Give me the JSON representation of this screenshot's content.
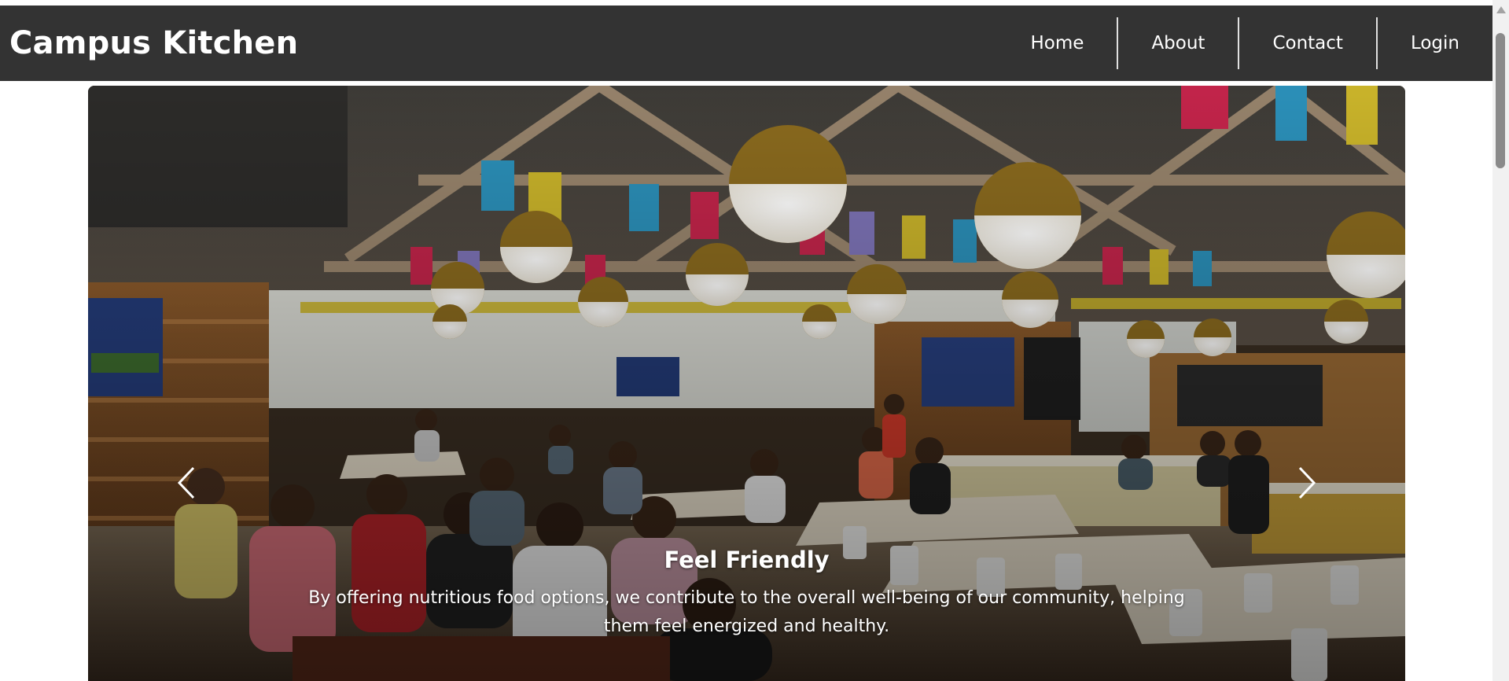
{
  "brand": {
    "name": "Campus Kitchen"
  },
  "nav": {
    "home": "Home",
    "about": "About",
    "contact": "Contact",
    "login": "Login"
  },
  "carousel": {
    "slide": {
      "image": "campus cafeteria dining hall",
      "title": "Feel Friendly",
      "text": "By offering nutritious food options, we contribute to the overall well-being of our community, helping them feel energized and healthy."
    },
    "prev_icon": "chevron-left-icon",
    "next_icon": "chevron-right-icon"
  },
  "colors": {
    "navbar": "#333333",
    "nav_text": "#ffffff",
    "page_bg": "#ffffff"
  }
}
